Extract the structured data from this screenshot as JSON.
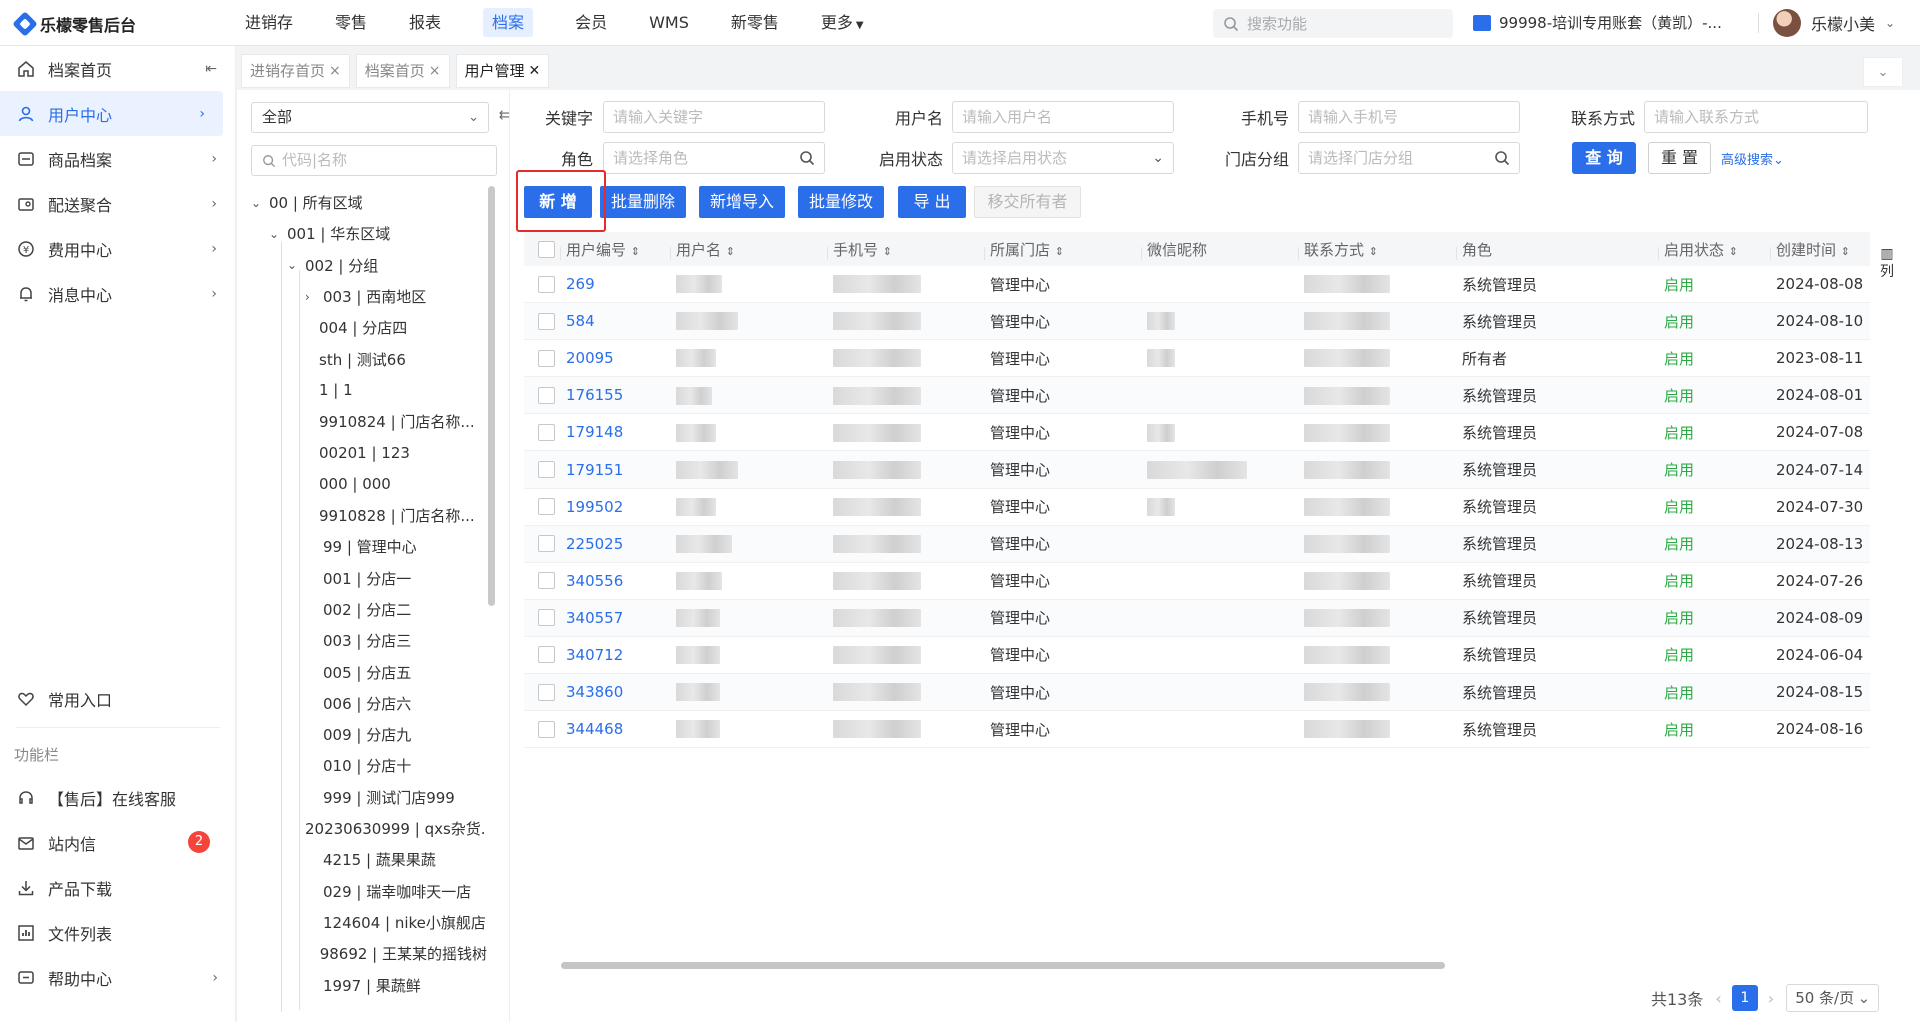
{
  "header": {
    "brand": "乐檬零售后台",
    "nav": [
      "进销存",
      "零售",
      "报表",
      "档案",
      "会员",
      "WMS",
      "新零售",
      "更多"
    ],
    "active_nav": "档案",
    "search_placeholder": "搜索功能",
    "account": "99998-培训专用账套（黄凯）-...",
    "username": "乐檬小美"
  },
  "sidebar": {
    "items": [
      {
        "label": "档案首页",
        "icon": "home-icon"
      },
      {
        "label": "用户中心",
        "icon": "user-icon"
      },
      {
        "label": "商品档案",
        "icon": "goods-icon"
      },
      {
        "label": "配送聚合",
        "icon": "delivery-icon"
      },
      {
        "label": "费用中心",
        "icon": "money-icon"
      },
      {
        "label": "消息中心",
        "icon": "bell-icon"
      }
    ],
    "favorites": "常用入口",
    "section_title": "功能栏",
    "functions": [
      {
        "label": "【售后】在线客服",
        "icon": "headset-icon"
      },
      {
        "label": "站内信",
        "icon": "mail-icon",
        "badge": "2"
      },
      {
        "label": "产品下载",
        "icon": "download-icon"
      },
      {
        "label": "文件列表",
        "icon": "chart-icon"
      },
      {
        "label": "帮助中心",
        "icon": "help-icon"
      }
    ]
  },
  "tabs": [
    {
      "label": "进销存首页",
      "active": false
    },
    {
      "label": "档案首页",
      "active": false
    },
    {
      "label": "用户管理",
      "active": true
    }
  ],
  "tree_panel": {
    "select_value": "全部",
    "search_placeholder": "代码|名称",
    "nodes": [
      {
        "label": "00 | 所有区域",
        "level": 0,
        "arrow": "down"
      },
      {
        "label": "001 | 华东区域",
        "level": 1,
        "arrow": "down"
      },
      {
        "label": "002 | 分组",
        "level": 2,
        "arrow": "down"
      },
      {
        "label": "003 | 西南地区",
        "level": 3,
        "arrow": "right"
      },
      {
        "label": "004 | 分店四",
        "level": 4,
        "arrow": ""
      },
      {
        "label": "sth | 测试66",
        "level": 4,
        "arrow": ""
      },
      {
        "label": "1 | 1",
        "level": 4,
        "arrow": ""
      },
      {
        "label": "9910824 | 门店名称...",
        "level": 4,
        "arrow": ""
      },
      {
        "label": "00201 | 123",
        "level": 4,
        "arrow": ""
      },
      {
        "label": "000 | 000",
        "level": 4,
        "arrow": ""
      },
      {
        "label": "9910828 | 门店名称...",
        "level": 4,
        "arrow": ""
      },
      {
        "label": "99 | 管理中心",
        "level": 3,
        "arrow": ""
      },
      {
        "label": "001 | 分店一",
        "level": 3,
        "arrow": ""
      },
      {
        "label": "002 | 分店二",
        "level": 3,
        "arrow": ""
      },
      {
        "label": "003 | 分店三",
        "level": 3,
        "arrow": ""
      },
      {
        "label": "005 | 分店五",
        "level": 3,
        "arrow": ""
      },
      {
        "label": "006 | 分店六",
        "level": 3,
        "arrow": ""
      },
      {
        "label": "009 | 分店九",
        "level": 3,
        "arrow": ""
      },
      {
        "label": "010 | 分店十",
        "level": 3,
        "arrow": ""
      },
      {
        "label": "999 | 测试门店999",
        "level": 3,
        "arrow": ""
      },
      {
        "label": "20230630999 | qxs杂货...",
        "level": 3,
        "arrow": ""
      },
      {
        "label": "4215 | 蔬果果蔬",
        "level": 3,
        "arrow": ""
      },
      {
        "label": "029 | 瑞幸咖啡天一店",
        "level": 3,
        "arrow": ""
      },
      {
        "label": "124604 | nike小旗舰店",
        "level": 3,
        "arrow": ""
      },
      {
        "label": "98692 | 王某某的摇钱树",
        "level": 3,
        "arrow": ""
      },
      {
        "label": "1997 | 果蔬鲜",
        "level": 3,
        "arrow": ""
      }
    ]
  },
  "filters": {
    "keyword": {
      "label": "关键字",
      "placeholder": "请输入关键字"
    },
    "username": {
      "label": "用户名",
      "placeholder": "请输入用户名"
    },
    "phone": {
      "label": "手机号",
      "placeholder": "请输入手机号"
    },
    "contact": {
      "label": "联系方式",
      "placeholder": "请输入联系方式"
    },
    "role": {
      "label": "角色",
      "placeholder": "请选择角色"
    },
    "status": {
      "label": "启用状态",
      "placeholder": "请选择启用状态"
    },
    "store_group": {
      "label": "门店分组",
      "placeholder": "请选择门店分组"
    },
    "query": "查 询",
    "reset": "重 置",
    "advanced": "高级搜索"
  },
  "actions": {
    "add": "新 增",
    "batch_delete": "批量删除",
    "batch_import": "新增导入",
    "batch_edit": "批量修改",
    "export": "导 出",
    "transfer_owner": "移交所有者"
  },
  "table": {
    "columns": [
      "用户编号",
      "用户名",
      "手机号",
      "所属门店",
      "微信昵称",
      "联系方式",
      "角色",
      "启用状态",
      "创建时间"
    ],
    "column_settings": "列",
    "rows": [
      {
        "id": "269",
        "store": "管理中心",
        "role": "系统管理员",
        "status": "启用",
        "created": "2024-08-08"
      },
      {
        "id": "584",
        "store": "管理中心",
        "role": "系统管理员",
        "status": "启用",
        "created": "2024-08-10"
      },
      {
        "id": "20095",
        "store": "管理中心",
        "role": "所有者",
        "status": "启用",
        "created": "2023-08-11"
      },
      {
        "id": "176155",
        "store": "管理中心",
        "role": "系统管理员",
        "status": "启用",
        "created": "2024-08-01"
      },
      {
        "id": "179148",
        "store": "管理中心",
        "role": "系统管理员",
        "status": "启用",
        "created": "2024-07-08"
      },
      {
        "id": "179151",
        "store": "管理中心",
        "role": "系统管理员",
        "status": "启用",
        "created": "2024-07-14"
      },
      {
        "id": "199502",
        "store": "管理中心",
        "role": "系统管理员",
        "status": "启用",
        "created": "2024-07-30"
      },
      {
        "id": "225025",
        "store": "管理中心",
        "role": "系统管理员",
        "status": "启用",
        "created": "2024-08-13"
      },
      {
        "id": "340556",
        "store": "管理中心",
        "role": "系统管理员",
        "status": "启用",
        "created": "2024-07-26"
      },
      {
        "id": "340557",
        "store": "管理中心",
        "role": "系统管理员",
        "status": "启用",
        "created": "2024-08-09"
      },
      {
        "id": "340712",
        "store": "管理中心",
        "role": "系统管理员",
        "status": "启用",
        "created": "2024-06-04"
      },
      {
        "id": "343860",
        "store": "管理中心",
        "role": "系统管理员",
        "status": "启用",
        "created": "2024-08-15"
      },
      {
        "id": "344468",
        "store": "管理中心",
        "role": "系统管理员",
        "status": "启用",
        "created": "2024-08-16"
      }
    ]
  },
  "pagination": {
    "total": "共13条",
    "current": "1",
    "page_size": "50 条/页"
  },
  "colors": {
    "primary": "#2a6ee9",
    "enabled": "#2dab44",
    "highlight_box": "#e52b2b"
  }
}
